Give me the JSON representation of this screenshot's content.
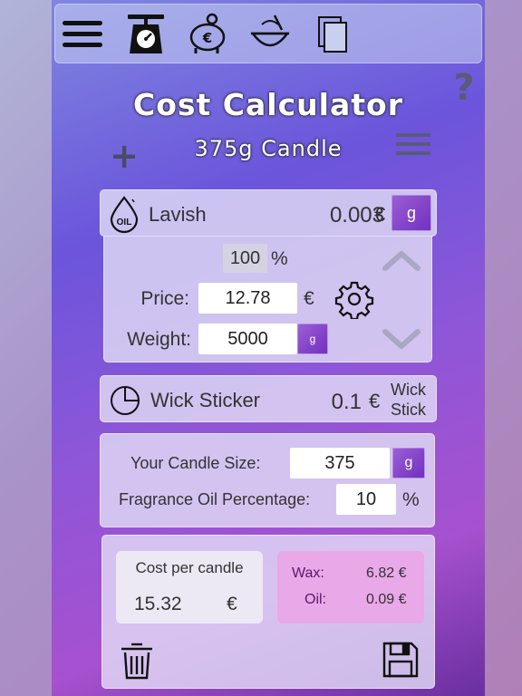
{
  "title": "Cost Calculator",
  "subtitle": "375g Candle",
  "toolbar": {
    "icons": [
      "menu-icon",
      "scale-icon",
      "piggy-bank-icon",
      "mixing-bowl-icon",
      "documents-icon"
    ],
    "piggy_symbol": "€"
  },
  "help_label": "?",
  "add_label": "+",
  "ingredient_oil": {
    "icon_label": "OIL",
    "name": "Lavish",
    "cost": "0.003",
    "currency": "€",
    "unit": "g",
    "percent_value": "100",
    "percent_sign": "%",
    "price_label": "Price:",
    "price_value": "12.78",
    "price_currency": "€",
    "weight_label": "Weight:",
    "weight_value": "5000",
    "weight_unit": "g"
  },
  "ingredient_wick": {
    "name": "Wick Sticker",
    "cost": "0.1",
    "currency": "€",
    "unit_line1": "Wick",
    "unit_line2": "Stick"
  },
  "settings": {
    "candle_size_label": "Your Candle Size:",
    "candle_size_value": "375",
    "candle_size_unit": "g",
    "fragrance_label": "Fragrance Oil Percentage:",
    "fragrance_value": "10",
    "fragrance_unit": "%"
  },
  "summary": {
    "cost_label": "Cost per candle",
    "cost_value": "15.32",
    "cost_currency": "€",
    "wax_label": "Wax:",
    "wax_value": "6.82 €",
    "oil_label": "Oil:",
    "oil_value": "0.09 €"
  },
  "colors": {
    "accent": "#7b3fc9",
    "summary_pink": "#e9a8e8"
  }
}
